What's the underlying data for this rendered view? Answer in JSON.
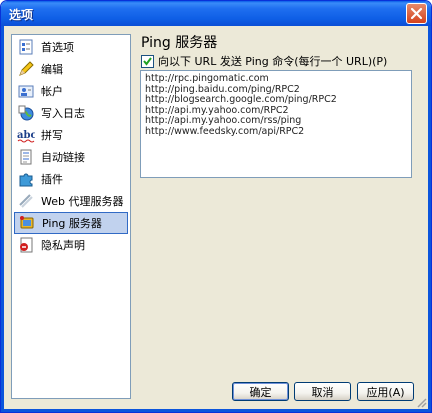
{
  "window": {
    "title": "选项"
  },
  "sidebar": {
    "items": [
      {
        "label": "首选项",
        "icon": "preferences-icon"
      },
      {
        "label": "编辑",
        "icon": "pencil-icon"
      },
      {
        "label": "帐户",
        "icon": "account-icon"
      },
      {
        "label": "写入日志",
        "icon": "globe-log-icon"
      },
      {
        "label": "拼写",
        "icon": "spelling-abc-icon"
      },
      {
        "label": "自动链接",
        "icon": "autolink-icon"
      },
      {
        "label": "插件",
        "icon": "puzzle-icon"
      },
      {
        "label": "Web 代理服务器",
        "icon": "web-proxy-icon"
      },
      {
        "label": "Ping 服务器",
        "icon": "ping-server-icon",
        "selected": true
      },
      {
        "label": "隐私声明",
        "icon": "privacy-icon"
      }
    ]
  },
  "main": {
    "title": "Ping 服务器",
    "checkbox_label": "向以下 URL 发送 Ping 命令(每行一个 URL)(P)",
    "checked": true,
    "urls": [
      "http://rpc.pingomatic.com",
      "http://ping.baidu.com/ping/RPC2",
      "http://blogsearch.google.com/ping/RPC2",
      "http://api.my.yahoo.com/RPC2",
      "http://api.my.yahoo.com/rss/ping",
      "http://www.feedsky.com/api/RPC2"
    ]
  },
  "buttons": {
    "ok": "确定",
    "cancel": "取消",
    "apply": "应用(A)"
  }
}
